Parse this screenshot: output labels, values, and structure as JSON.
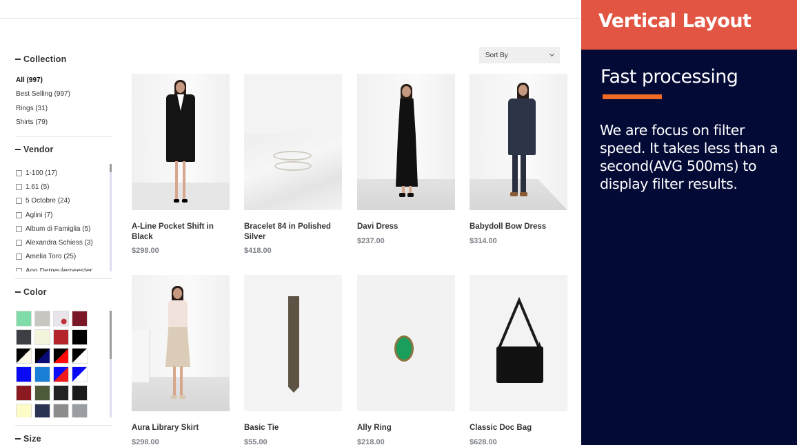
{
  "sidebar": {
    "collection": {
      "title": "Collection",
      "items": [
        {
          "label": "All (997)",
          "active": true
        },
        {
          "label": "Best Selling (997)"
        },
        {
          "label": "Rings (31)"
        },
        {
          "label": "Shirts (79)"
        }
      ]
    },
    "vendor": {
      "title": "Vendor",
      "items": [
        "1-100 (17)",
        "1.61 (5)",
        "5 Octobre (24)",
        "Aglini (7)",
        "Album di Famiglia (5)",
        "Alexandra Schiess (3)",
        "Amelia Toro (25)",
        "Ann Demeulemeester"
      ]
    },
    "color": {
      "title": "Color",
      "swatches": [
        {
          "name": "mint",
          "fill": "#7fdca8"
        },
        {
          "name": "light-grey",
          "fill": "#c8c6c1"
        },
        {
          "name": "floral-print",
          "fill": "#e8e4ea",
          "accent": "#c0303a"
        },
        {
          "name": "burgundy",
          "fill": "#7b1828"
        },
        {
          "name": "charcoal-knit",
          "fill": "#3c3f44"
        },
        {
          "name": "cream",
          "fill": "#f4f3dc"
        },
        {
          "name": "red-pattern",
          "fill": "#b3242c"
        },
        {
          "name": "black",
          "fill": "#000000"
        },
        {
          "name": "black-cream",
          "fill": "#000000",
          "split": "#fbf6e6"
        },
        {
          "name": "black-navy",
          "fill": "#000000",
          "split": "#0a0a78"
        },
        {
          "name": "black-red",
          "fill": "#000000",
          "split": "#ff0a0a"
        },
        {
          "name": "black-white",
          "fill": "#000000",
          "split": "#ffffff"
        },
        {
          "name": "blue",
          "fill": "#0a0af5"
        },
        {
          "name": "azure",
          "fill": "#1a7fd6"
        },
        {
          "name": "blue-red",
          "fill": "#0a0af5",
          "split": "#f01a1a"
        },
        {
          "name": "blue-white",
          "fill": "#0a0af5",
          "split": "#ffffff"
        },
        {
          "name": "dark-red",
          "fill": "#8a1a20"
        },
        {
          "name": "camo",
          "fill": "#4d5a3a"
        },
        {
          "name": "dark-grey",
          "fill": "#222222"
        },
        {
          "name": "near-black",
          "fill": "#1a1a1a"
        },
        {
          "name": "pale-yellow",
          "fill": "#fdfcc8"
        },
        {
          "name": "navy-knit",
          "fill": "#2a3452"
        },
        {
          "name": "salt-pepper",
          "fill": "#8c8c8c"
        },
        {
          "name": "grey",
          "fill": "#9a9ea3"
        }
      ]
    },
    "size": {
      "title": "Size"
    }
  },
  "sort": {
    "label": "Sort By"
  },
  "products": [
    {
      "name": "A-Line Pocket Shift in Black",
      "price": "$298.00",
      "image": "model-black-dress"
    },
    {
      "name": "Bracelet 84 in Polished Silver",
      "price": "$418.00",
      "image": "silver-bracelet"
    },
    {
      "name": "Davi Dress",
      "price": "$237.00",
      "image": "model-black-midi-dress"
    },
    {
      "name": "Babydoll Bow Dress",
      "price": "$314.00",
      "image": "model-navy-dress"
    },
    {
      "name": "Aura Library Skirt",
      "price": "$298.00",
      "image": "model-beige-skirt"
    },
    {
      "name": "Basic Tie",
      "price": "$55.00",
      "image": "brown-tie"
    },
    {
      "name": "Ally Ring",
      "price": "$218.00",
      "image": "green-stone-ring"
    },
    {
      "name": "Classic Doc Bag",
      "price": "$628.00",
      "image": "black-messenger-bag"
    }
  ],
  "panel": {
    "title": "Vertical Layout",
    "subtitle": "Fast processing",
    "body": "We are focus on filter speed. It takes less than a second(AVG 500ms) to display filter results.",
    "colors": {
      "header": "#e15542",
      "background": "#030a36",
      "accent": "#ef6b25"
    }
  }
}
